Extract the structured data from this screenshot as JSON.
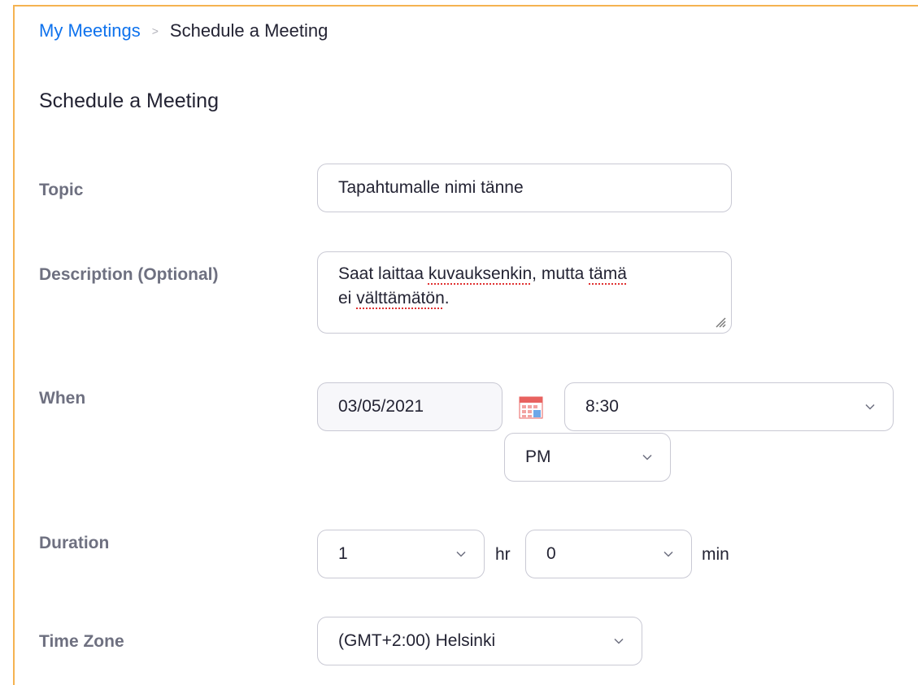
{
  "breadcrumb": {
    "parent": "My Meetings",
    "separator": ">",
    "current": "Schedule a Meeting"
  },
  "page_title": "Schedule a Meeting",
  "form": {
    "topic": {
      "label": "Topic",
      "value": "Tapahtumalle nimi tänne"
    },
    "description": {
      "label": "Description (Optional)",
      "line1_a": "Saat laittaa ",
      "line1_b": "kuvauksenkin",
      "line1_c": ", mutta ",
      "line1_d": "tämä",
      "line2_a": "ei ",
      "line2_b": "välttämätön",
      "line2_c": "."
    },
    "when": {
      "label": "When",
      "date": "03/05/2021",
      "time": "8:30",
      "ampm": "PM"
    },
    "duration": {
      "label": "Duration",
      "hours": "1",
      "hours_unit": "hr",
      "minutes": "0",
      "minutes_unit": "min"
    },
    "timezone": {
      "label": "Time Zone",
      "value": "(GMT+2:00) Helsinki"
    }
  },
  "colors": {
    "accent_link": "#0e72ed",
    "frame_border": "#f5b351",
    "label": "#6e7080",
    "input_border": "#c9c9d4",
    "calendar_icon": "#e8625f"
  },
  "icons": [
    "calendar-icon",
    "chevron-down-icon",
    "resize-grip-icon"
  ]
}
